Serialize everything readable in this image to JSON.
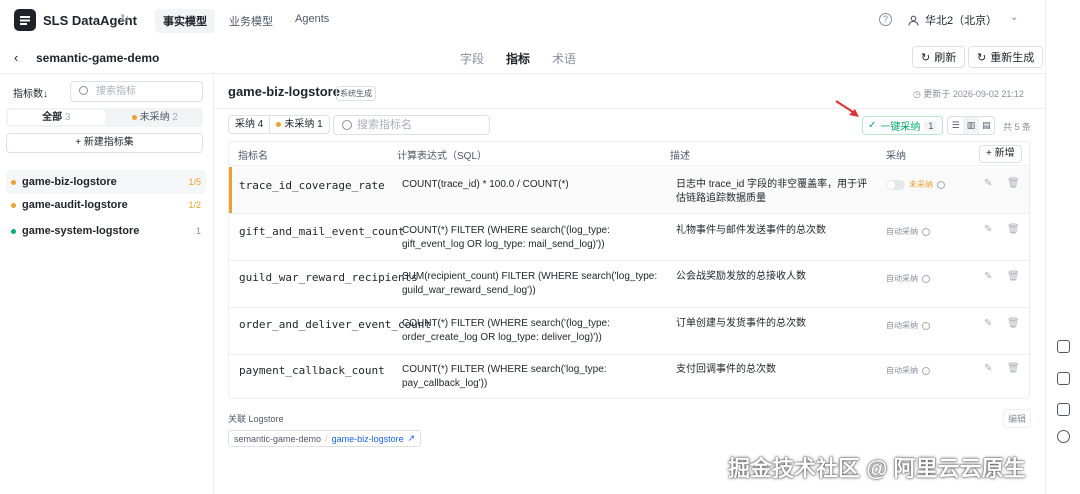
{
  "app": {
    "name": "SLS DataAgent",
    "refresh_glyph": "↻"
  },
  "topnav": [
    "事实模型",
    "业务模型",
    "Agents"
  ],
  "topnav_active": 0,
  "user": {
    "region": "华北2（北京）",
    "help_glyph": "?"
  },
  "project": {
    "name": "semantic-game-demo",
    "back_glyph": "‹"
  },
  "content_tabs": [
    "字段",
    "指标",
    "术语"
  ],
  "content_tabs_active": 1,
  "header_buttons": {
    "refresh": "刷新",
    "regenerate": "重新生成"
  },
  "sidebar": {
    "sort_label": "指标数↓",
    "search_placeholder": "搜索指标",
    "segments": {
      "all_label": "全部",
      "all_count": "3",
      "unadopted_label": "未采纳",
      "unadopted_count": "2"
    },
    "new_set": "+ 新建指标集",
    "items": [
      {
        "name": "game-biz-logstore",
        "count": "1/5",
        "dot": "#f0a030",
        "count_color": "#f0a030"
      },
      {
        "name": "game-audit-logstore",
        "count": "1/2",
        "dot": "#f0a030",
        "count_color": "#f0a030"
      },
      {
        "name": "game-system-logstore",
        "count": "1",
        "dot": "#00b478",
        "count_color": "#86909c"
      }
    ]
  },
  "main": {
    "logstore_title": "game-biz-logstore",
    "tag": "系统生成",
    "updated": "更新于 2026-09-02 21:12",
    "filter_adopted": "采纳 4",
    "filter_unadopted": "未采纳 1",
    "search_placeholder": "搜索指标名",
    "adopt_all": "一键采纳",
    "adopt_all_count": "1",
    "total": "共 5 条",
    "columns": {
      "name": "指标名",
      "expr": "计算表达式（SQL）",
      "desc": "描述",
      "adopt": "采纳",
      "add": "+ 新增"
    },
    "rows": [
      {
        "name": "trace_id_coverage_rate",
        "expr": "COUNT(trace_id) * 100.0 / COUNT(*)",
        "desc": "日志中 trace_id 字段的非空覆盖率，用于评估链路追踪数据质量",
        "adopt": "未采纳"
      },
      {
        "name": "gift_and_mail_event_count",
        "expr": "COUNT(*) FILTER (WHERE search('(log_type: gift_event_log OR log_type: mail_send_log)'))",
        "desc": "礼物事件与邮件发送事件的总次数",
        "adopt": "自动采纳"
      },
      {
        "name": "guild_war_reward_recipients",
        "expr": "SUM(recipient_count) FILTER (WHERE search('log_type: guild_war_reward_send_log'))",
        "desc": "公会战奖励发放的总接收人数",
        "adopt": "自动采纳"
      },
      {
        "name": "order_and_deliver_event_count",
        "expr": "COUNT(*) FILTER (WHERE search('(log_type: order_create_log OR log_type: deliver_log)'))",
        "desc": "订单创建与发货事件的总次数",
        "adopt": "自动采纳"
      },
      {
        "name": "payment_callback_count",
        "expr": "COUNT(*) FILTER (WHERE search('log_type: pay_callback_log'))",
        "desc": "支付回调事件的总次数",
        "adopt": "自动采纳"
      }
    ],
    "related_label": "关联 Logstore",
    "edit": "编辑",
    "related_project": "semantic-game-demo",
    "related_logstore": "game-biz-logstore"
  },
  "colors": {
    "accent_orange": "#f0a030",
    "accent_green": "#00a86b",
    "link_blue": "#1664ff",
    "arrow_red": "#e03030"
  },
  "watermark": "掘金技术社区 @ 阿里云云原生"
}
